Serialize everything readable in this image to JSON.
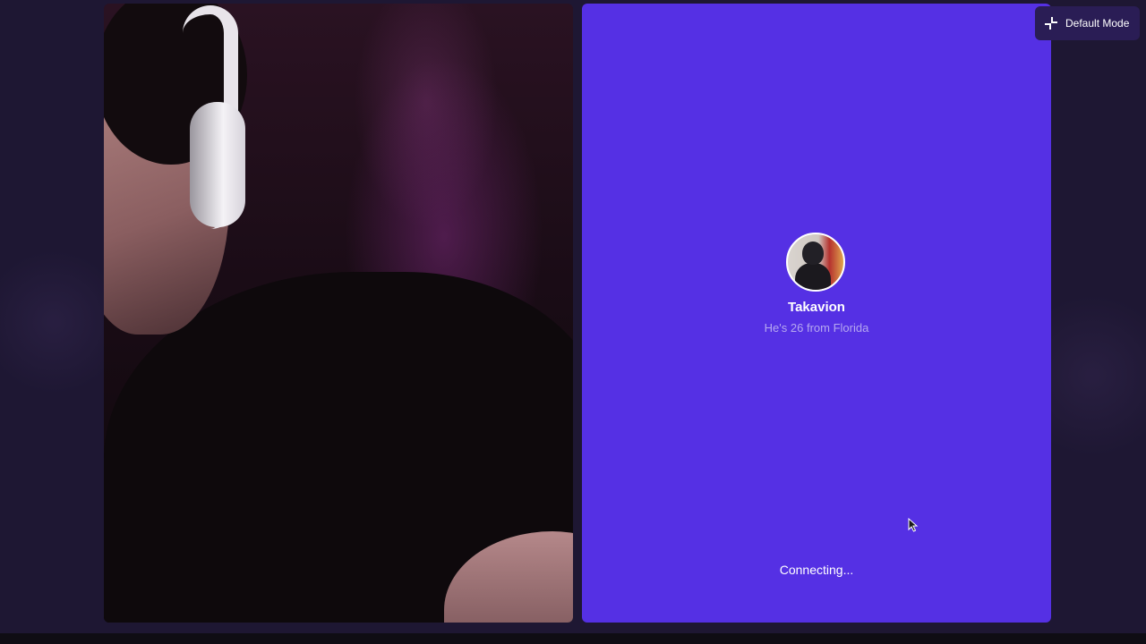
{
  "mode_toggle": {
    "label": "Default Mode",
    "icon": "collapse-icon"
  },
  "local_video": {
    "description_icon": "camera-feed"
  },
  "remote": {
    "name": "Takavion",
    "subtitle": "He's 26 from Florida",
    "status": "Connecting...",
    "panel_color": "#5530e4"
  }
}
